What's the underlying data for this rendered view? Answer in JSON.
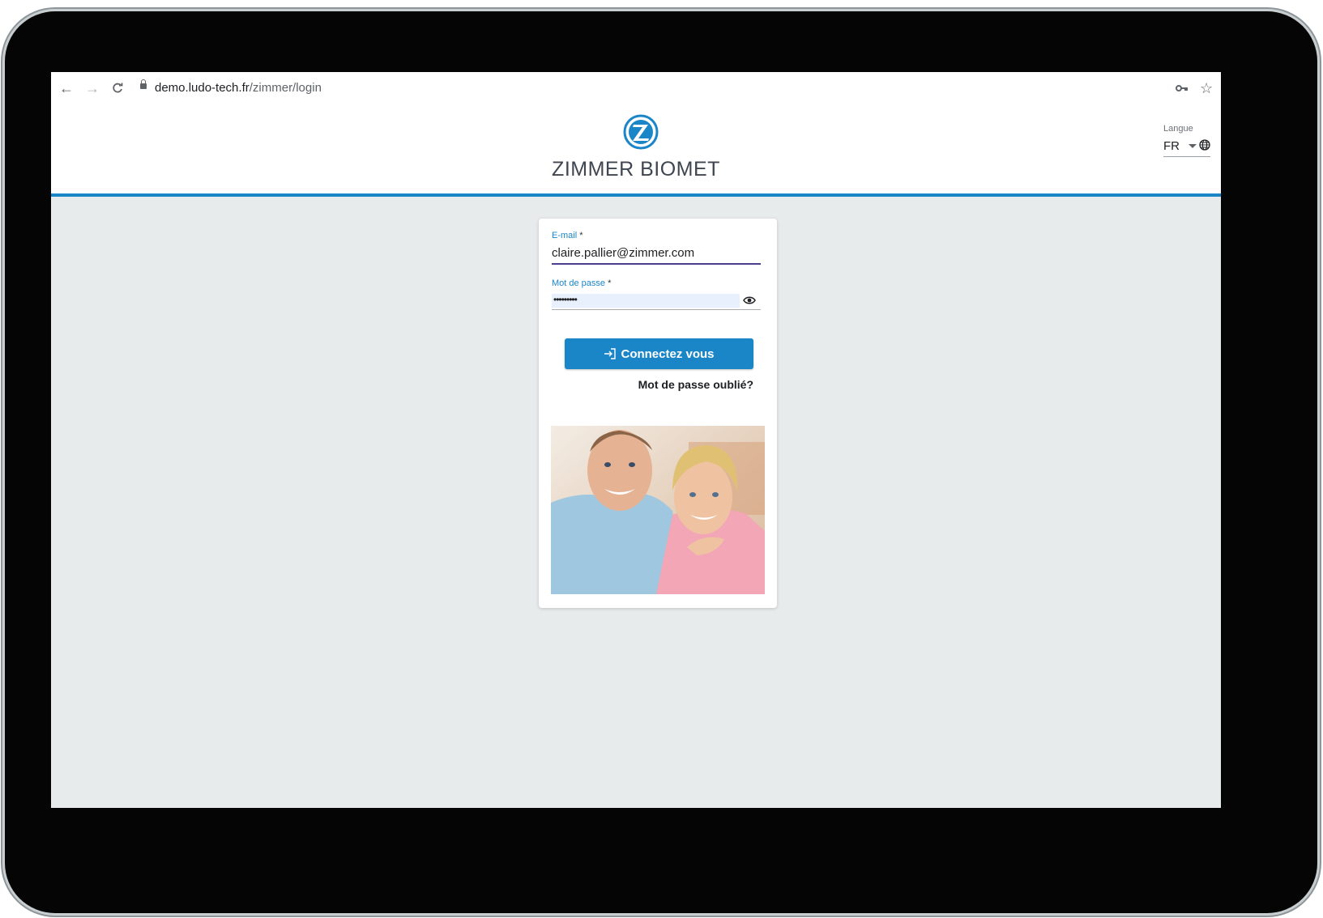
{
  "browser": {
    "url_host": "demo.ludo-tech.fr",
    "url_path": "/zimmer/login",
    "icons": [
      "back-arrow-icon",
      "forward-arrow-icon",
      "reload-icon",
      "lock-icon",
      "key-icon",
      "star-icon"
    ]
  },
  "header": {
    "brand": "ZIMMER BIOMET",
    "logo_letter": "Z",
    "accent_color": "#1a86c8",
    "language": {
      "label": "Langue",
      "value": "FR"
    }
  },
  "login": {
    "email_label": "E-mail",
    "email_required_mark": "*",
    "email_value": "claire.pallier@zimmer.com",
    "password_label": "Mot de passe",
    "password_required_mark": "*",
    "password_masked": "•••••••••",
    "submit_label": "Connectez vous",
    "forgot_label": "Mot de passe oublié?"
  }
}
